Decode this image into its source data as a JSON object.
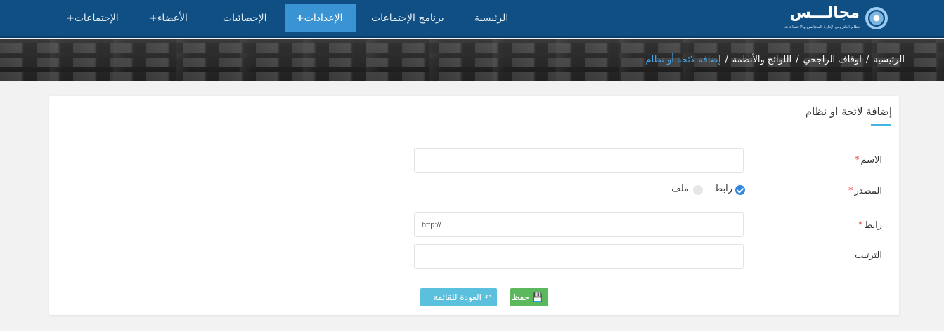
{
  "navbar": {
    "logo": {
      "word": "مجالـــس",
      "subtitle": "نظام الكتروني لإدارة المجالس والاجتماعات"
    },
    "items": [
      {
        "label": "الرئيسية",
        "plus": ""
      },
      {
        "label": "برنامج الإجتماعات",
        "plus": ""
      },
      {
        "label": "الإعدادات",
        "plus": "+",
        "active": true
      },
      {
        "label": "الإحصائيات",
        "plus": ""
      },
      {
        "label": "الأعضاء",
        "plus": "+"
      },
      {
        "label": "الإجتماعات",
        "plus": "+"
      }
    ]
  },
  "breadcrumb": {
    "home": "الرئيسية",
    "org": "اوقاف الراجحي",
    "section": "اللوائح والأنظمة",
    "current": "إضافة لائحة أو نظام",
    "separator": "/"
  },
  "form": {
    "title": "إضافة لائحة او نظام",
    "required_mark": "*",
    "name_label": "الاسم",
    "name_value": "",
    "source_label": "المصدر",
    "source_options": {
      "link": "رابط",
      "file": "ملف"
    },
    "source_selected": "link",
    "link_label": "رابط",
    "link_value": "http://",
    "order_label": "الترتيب",
    "order_value": ""
  },
  "buttons": {
    "save": "حفظ",
    "back": "العودة للقائمة"
  },
  "colors": {
    "navbar": "#0f4f83",
    "active_tab": "#3a93d3",
    "save": "#5cb85c",
    "back": "#5bc0de",
    "required": "#e53935"
  }
}
